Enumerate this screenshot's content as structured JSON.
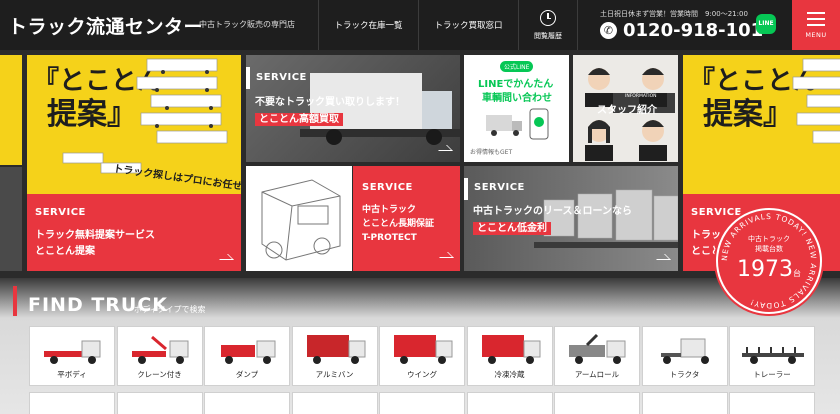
{
  "header": {
    "logo": "トラック流通センター",
    "tagline": "中古トラック販売の専門店",
    "nav": [
      {
        "label": "トラック在庫一覧"
      },
      {
        "label": "トラック買取窓口"
      },
      {
        "label": "閲覧履歴"
      }
    ],
    "hours": "土日祝日休まず営業！営業時間　9:00～21:00",
    "phone": "0120-918-101",
    "line_label": "LINE",
    "menu_label": "MENU"
  },
  "banners": {
    "left_proposal": {
      "quote": "『とことん",
      "quote2": "提案』",
      "slogan": "トラック探しはプロにお任せ!",
      "service_tag": "SERVICE",
      "title1": "トラック無料提案サービス",
      "title2": "とことん提案"
    },
    "buyback": {
      "service_tag": "SERVICE",
      "line1": "不要なトラック買い取りします！",
      "line2": "とことん高額買取"
    },
    "line_inquiry": {
      "badge": "公式LINE",
      "line1": "LINEでかんたん",
      "line2": "車輌問い合わせ",
      "note": "お得情報もGET"
    },
    "staff": {
      "small": "INFORMATION",
      "label": "スタッフ紹介"
    },
    "protect": {
      "service_tag": "SERVICE",
      "line1": "中古トラック",
      "line2": "とことん長期保証",
      "line3": "T-PROTECT"
    },
    "lease": {
      "service_tag": "SERVICE",
      "line1": "中古トラックのリース＆ローンなら",
      "line2": "とことん低金利"
    },
    "right_proposal": {
      "quote": "『とことん",
      "quote2": "提案』",
      "service_tag": "SERVICE",
      "title1": "トラック",
      "title2": "とことん"
    }
  },
  "badge": {
    "ring_text": "NEW ARRIVALS TODAY! NEW ARRIVALS TODAY!",
    "label1": "中古トラック",
    "label2": "掲載台数",
    "count": "1973",
    "unit": "台"
  },
  "find_truck": {
    "title": "FIND TRUCK",
    "subtitle": "ボディタイプで検索",
    "types": [
      {
        "label": "平ボディ",
        "icon": "flatbed-truck-icon"
      },
      {
        "label": "クレーン付き",
        "icon": "crane-truck-icon"
      },
      {
        "label": "ダンプ",
        "icon": "dump-truck-icon"
      },
      {
        "label": "アルミバン",
        "icon": "aluminum-van-icon"
      },
      {
        "label": "ウイング",
        "icon": "wing-truck-icon"
      },
      {
        "label": "冷凍冷蔵",
        "icon": "refrigerated-truck-icon"
      },
      {
        "label": "アームロール",
        "icon": "arm-roll-truck-icon"
      },
      {
        "label": "トラクタ",
        "icon": "tractor-head-icon"
      },
      {
        "label": "トレーラー",
        "icon": "trailer-icon"
      }
    ]
  },
  "colors": {
    "accent": "#e8363f",
    "yellow": "#f5d21a",
    "dark": "#1e1e1e",
    "line_green": "#06c755"
  }
}
